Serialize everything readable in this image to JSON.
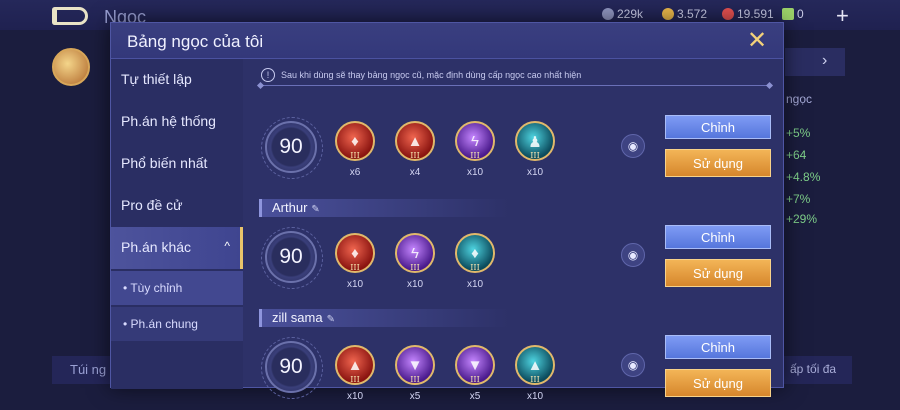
{
  "background": {
    "title": "Ngọc",
    "currency": [
      {
        "value": "229k",
        "color": "#8f94bf"
      },
      {
        "value": "3.572",
        "color": "#e8b64a"
      },
      {
        "value": "19.591",
        "color": "#e35050"
      },
      {
        "value": "0",
        "color": "#9dd36a"
      }
    ],
    "stats": [
      "+5%",
      "+64",
      "+4.8%",
      "+7%",
      "+29%"
    ],
    "right_label": "ngọc",
    "bottom_left": "Túi ng",
    "bottom_right": "ấp tối đa"
  },
  "modal": {
    "title": "Bảng ngọc của tôi",
    "close_label": "✕"
  },
  "sidebar": {
    "items": [
      {
        "label": "Tự thiết lập"
      },
      {
        "label": "Ph.án hệ thống"
      },
      {
        "label": "Phổ biến nhất"
      },
      {
        "label": "Pro đề cử"
      },
      {
        "label": "Ph.án khác",
        "chevron": "^"
      }
    ],
    "sub_items": [
      {
        "label": "• Tùy chỉnh"
      },
      {
        "label": "• Ph.án chung"
      }
    ]
  },
  "notice": {
    "icon": "!",
    "text": "Sau khi dùng sẽ thay bảng ngọc cũ, mặc định dùng cấp ngọc cao nhất hiện"
  },
  "sets": [
    {
      "name": "",
      "level": "90",
      "gems": [
        {
          "color": "red",
          "tier": "III",
          "count": "x6"
        },
        {
          "color": "red",
          "tier": "III",
          "count": "x4"
        },
        {
          "color": "purple",
          "tier": "III",
          "count": "x10"
        },
        {
          "color": "teal",
          "tier": "III",
          "count": "x10"
        }
      ],
      "edit_label": "Chỉnh",
      "use_label": "Sử dụng"
    },
    {
      "name": "Arthur",
      "level": "90",
      "gems": [
        {
          "color": "red",
          "tier": "III",
          "count": "x10"
        },
        {
          "color": "purple",
          "tier": "III",
          "count": "x10"
        },
        {
          "color": "teal",
          "tier": "III",
          "count": "x10"
        }
      ],
      "edit_label": "Chỉnh",
      "use_label": "Sử dụng"
    },
    {
      "name": "zill sama",
      "level": "90",
      "gems": [
        {
          "color": "red",
          "tier": "III",
          "count": "x10"
        },
        {
          "color": "purple",
          "tier": "III",
          "count": "x5"
        },
        {
          "color": "purple",
          "tier": "III",
          "count": "x5"
        },
        {
          "color": "teal",
          "tier": "III",
          "count": "x10"
        }
      ],
      "edit_label": "Chỉnh",
      "use_label": "Sử dụng"
    }
  ]
}
